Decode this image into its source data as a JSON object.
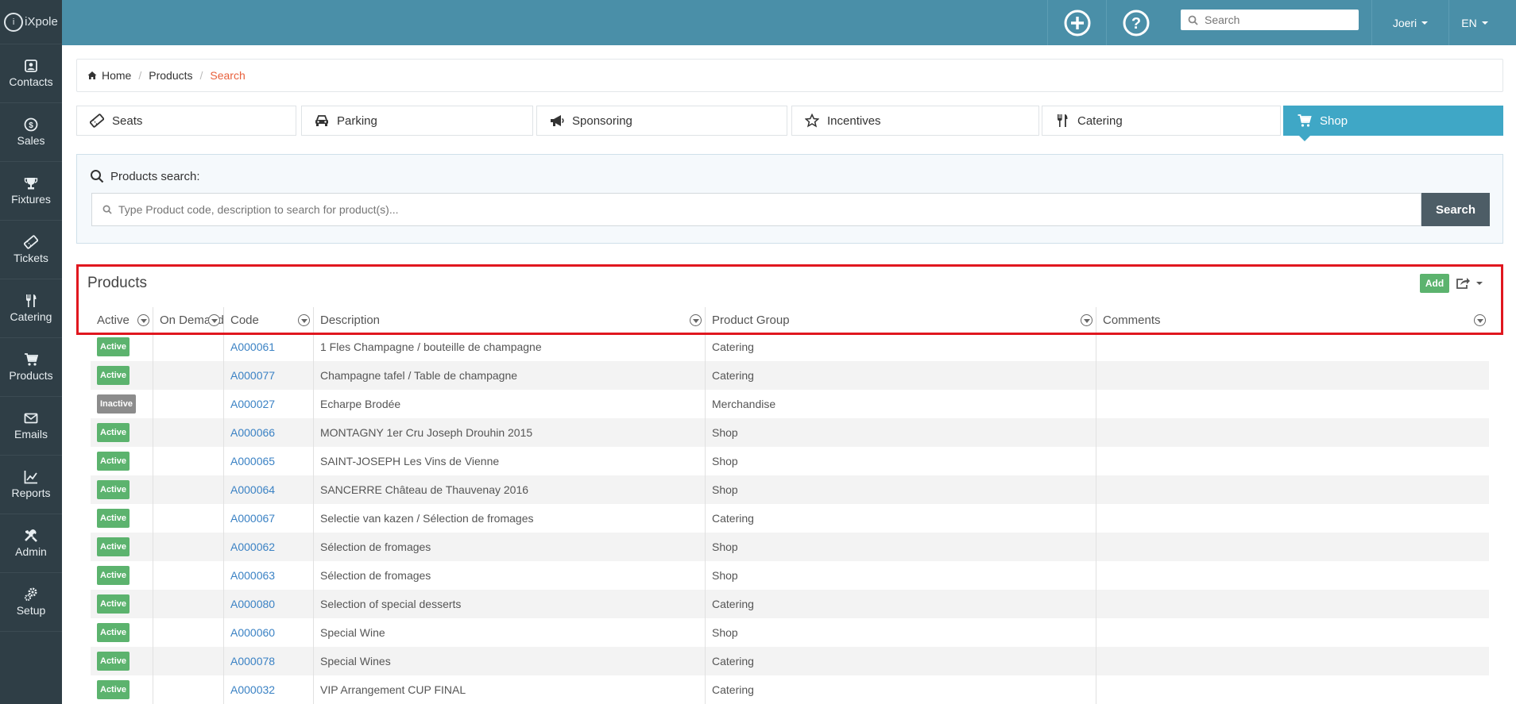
{
  "app": {
    "logo_text": "iXpole"
  },
  "sidebar": {
    "items": [
      {
        "label": "Contacts",
        "icon": "contacts-icon"
      },
      {
        "label": "Sales",
        "icon": "dollar-icon"
      },
      {
        "label": "Fixtures",
        "icon": "trophy-icon"
      },
      {
        "label": "Tickets",
        "icon": "ticket-icon"
      },
      {
        "label": "Catering",
        "icon": "cutlery-icon"
      },
      {
        "label": "Products",
        "icon": "cart-icon"
      },
      {
        "label": "Emails",
        "icon": "envelope-icon"
      },
      {
        "label": "Reports",
        "icon": "chart-icon"
      },
      {
        "label": "Admin",
        "icon": "tools-icon"
      },
      {
        "label": "Setup",
        "icon": "gears-icon"
      }
    ]
  },
  "topbar": {
    "search_placeholder": "Search",
    "user": "Joeri",
    "language": "EN"
  },
  "breadcrumb": {
    "home": "Home",
    "products": "Products",
    "current": "Search"
  },
  "categories": [
    {
      "label": "Seats",
      "icon": "ticket-icon"
    },
    {
      "label": "Parking",
      "icon": "car-icon"
    },
    {
      "label": "Sponsoring",
      "icon": "megaphone-icon"
    },
    {
      "label": "Incentives",
      "icon": "star-icon"
    },
    {
      "label": "Catering",
      "icon": "cutlery-icon"
    },
    {
      "label": "Shop",
      "icon": "cart-icon",
      "selected": true
    }
  ],
  "search": {
    "title": "Products search:",
    "placeholder": "Type Product code, description to search for product(s)...",
    "button": "Search"
  },
  "products": {
    "title": "Products",
    "add_label": "Add",
    "columns": [
      "Active",
      "On Demand",
      "Code",
      "Description",
      "Product Group",
      "Comments"
    ],
    "rows": [
      {
        "status": "Active",
        "on_demand": "",
        "code": "A000061",
        "description": "1 Fles Champagne / bouteille de champagne",
        "group": "Catering",
        "comments": ""
      },
      {
        "status": "Active",
        "on_demand": "",
        "code": "A000077",
        "description": "Champagne tafel / Table de champagne",
        "group": "Catering",
        "comments": ""
      },
      {
        "status": "Inactive",
        "on_demand": "",
        "code": "A000027",
        "description": "Echarpe Brodée",
        "group": "Merchandise",
        "comments": ""
      },
      {
        "status": "Active",
        "on_demand": "",
        "code": "A000066",
        "description": "MONTAGNY 1er Cru Joseph Drouhin 2015",
        "group": "Shop",
        "comments": ""
      },
      {
        "status": "Active",
        "on_demand": "",
        "code": "A000065",
        "description": "SAINT-JOSEPH Les Vins de Vienne",
        "group": "Shop",
        "comments": ""
      },
      {
        "status": "Active",
        "on_demand": "",
        "code": "A000064",
        "description": "SANCERRE Château de Thauvenay 2016",
        "group": "Shop",
        "comments": ""
      },
      {
        "status": "Active",
        "on_demand": "",
        "code": "A000067",
        "description": "Selectie van kazen / Sélection de fromages",
        "group": "Catering",
        "comments": ""
      },
      {
        "status": "Active",
        "on_demand": "",
        "code": "A000062",
        "description": "Sélection de fromages",
        "group": "Shop",
        "comments": ""
      },
      {
        "status": "Active",
        "on_demand": "",
        "code": "A000063",
        "description": "Sélection de fromages",
        "group": "Shop",
        "comments": ""
      },
      {
        "status": "Active",
        "on_demand": "",
        "code": "A000080",
        "description": "Selection of special desserts",
        "group": "Catering",
        "comments": ""
      },
      {
        "status": "Active",
        "on_demand": "",
        "code": "A000060",
        "description": "Special Wine",
        "group": "Shop",
        "comments": ""
      },
      {
        "status": "Active",
        "on_demand": "",
        "code": "A000078",
        "description": "Special Wines",
        "group": "Catering",
        "comments": ""
      },
      {
        "status": "Active",
        "on_demand": "",
        "code": "A000032",
        "description": "VIP Arrangement CUP FINAL",
        "group": "Catering",
        "comments": ""
      }
    ]
  },
  "colors": {
    "topbar": "#4a8fa8",
    "sidebar": "#2f3e46",
    "accent": "#3fa7c6",
    "active_badge": "#5cb36e",
    "inactive_badge": "#8c8c8c",
    "breadcrumb_active": "#e8603c",
    "highlight": "#e0171f"
  }
}
